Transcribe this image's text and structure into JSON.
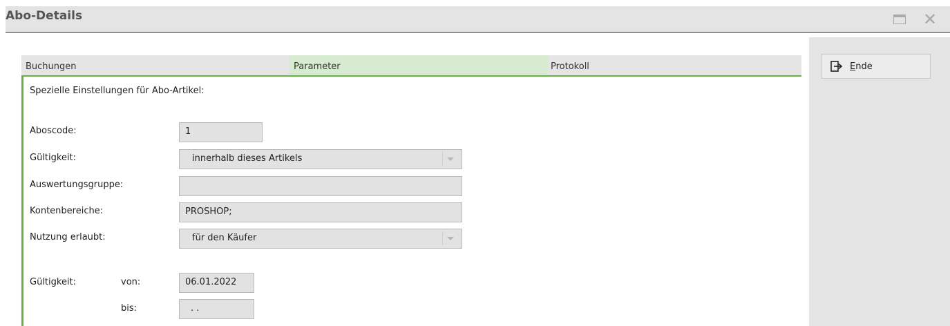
{
  "window": {
    "title": "Abo-Details"
  },
  "tabs": [
    {
      "label": "Buchungen",
      "active": false
    },
    {
      "label": "Parameter",
      "active": true
    },
    {
      "label": "Protokoll",
      "active": false
    }
  ],
  "form": {
    "heading": "Spezielle Einstellungen für Abo-Artikel:",
    "aboscode": {
      "label": "Aboscode:",
      "value": "1"
    },
    "gueltigkeit": {
      "label": "Gültigkeit:",
      "value": "innerhalb dieses Artikels"
    },
    "auswertungsgruppe": {
      "label": "Auswertungsgruppe:",
      "value": ""
    },
    "kontenbereiche": {
      "label": "Kontenbereiche:",
      "value": "PROSHOP;"
    },
    "nutzung": {
      "label": "Nutzung erlaubt:",
      "value": "für den Käufer"
    },
    "validity": {
      "label": "Gültigkeit:",
      "from_label": "von:",
      "from_value": "06.01.2022",
      "to_label": "bis:",
      "to_value": ". ."
    }
  },
  "actions": {
    "ende": {
      "label_first": "E",
      "label_rest": "nde",
      "icon": "exit-icon"
    }
  },
  "colors": {
    "accent": "#66b243",
    "active_tab": "#d7ebd0"
  }
}
